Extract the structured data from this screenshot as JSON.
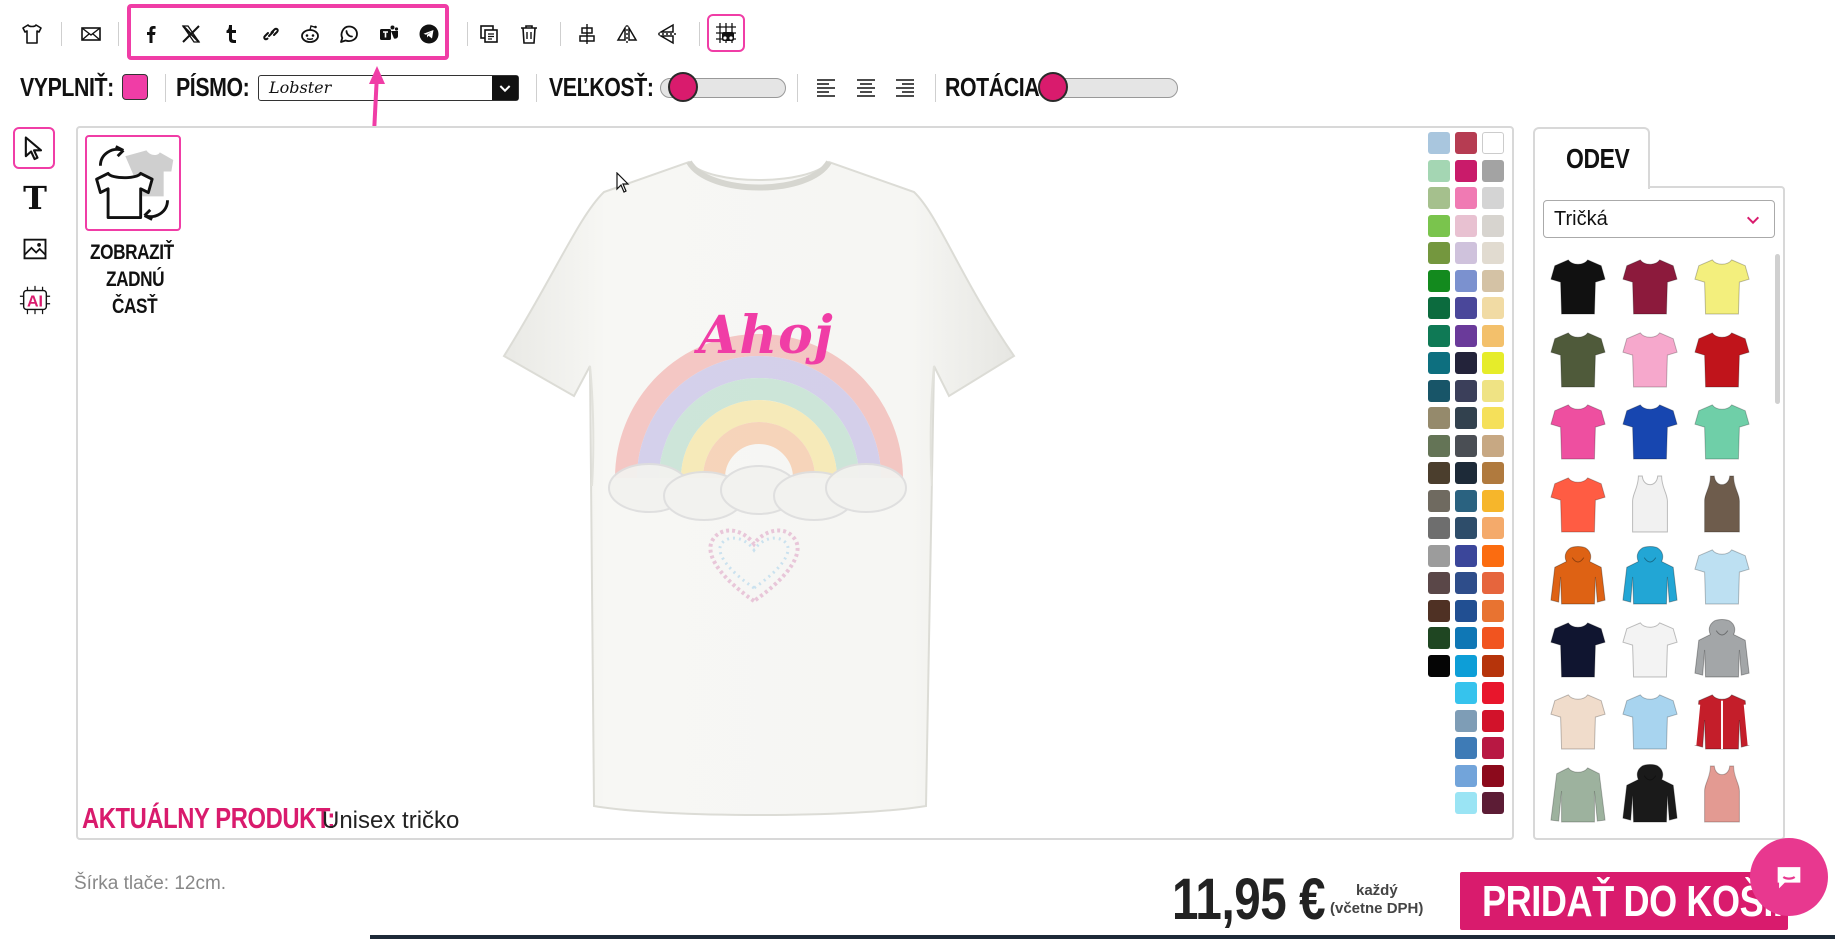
{
  "toolbar": {
    "share_icons": [
      "facebook-icon",
      "x-icon",
      "tumblr-icon",
      "link-icon",
      "reddit-icon",
      "whatsapp-icon",
      "teams-icon",
      "telegram-icon"
    ],
    "fill_label": "VYPLNIŤ:",
    "fill_color": "#f03da6",
    "font_label": "PÍSMO:",
    "font_value": "Lobster",
    "size_label": "VEĽKOSŤ:",
    "size_value": 0.05,
    "rotation_label": "ROTÁCIA:",
    "rotation_value": 0.0
  },
  "back_view": {
    "label_line1": "ZOBRAZIŤ",
    "label_line2": "ZADNÚ",
    "label_line3": "ČASŤ"
  },
  "canvas": {
    "design_text": "Ahoj",
    "current_product_label": "AKTUÁLNY PRODUKT:",
    "current_product_value": "Unisex tričko"
  },
  "palette": {
    "col1": [
      "#a9c6de",
      "#a4d6b3",
      "#a5c08d",
      "#7ac44d",
      "#74973e",
      "#138a1e",
      "#0c6b3e",
      "#0f7955",
      "#0d6f7f",
      "#185568",
      "#958a6c",
      "#647456",
      "#4b3e2d",
      "#6f6a60",
      "#6e6e6e",
      "#9c9c9c",
      "#5a4748",
      "#4f3124",
      "#1f4622",
      "#050505"
    ],
    "col2": [
      "#b63c52",
      "#c91b6a",
      "#f07ab3",
      "#e8c1d1",
      "#cfc2dc",
      "#7b91cf",
      "#4a479a",
      "#6a3a9a",
      "#23233a",
      "#3b3f5a",
      "#32414e",
      "#4a4e54",
      "#1d2a38",
      "#2a6280",
      "#2e4d6a",
      "#3b469a",
      "#2e4d8a",
      "#214f92",
      "#0f77b5",
      "#0d9ed7",
      "#36c3ed",
      "#7e9db6",
      "#3e7bb6",
      "#72a4da",
      "#9ae4f4"
    ],
    "col3": [
      "#ffffff",
      "#a3a3a3",
      "#d4d4d4",
      "#d7d4cf",
      "#e1dbd0",
      "#d4c2a5",
      "#f1dba4",
      "#f3c06b",
      "#e6ec2a",
      "#efe384",
      "#f5e05a",
      "#c7a883",
      "#b07a3e",
      "#f6b62b",
      "#f4aa6b",
      "#fb6c10",
      "#e6653d",
      "#e87331",
      "#f1541f",
      "#b6340b",
      "#e8162c",
      "#d2122a",
      "#b81843",
      "#8c0a1c",
      "#5c1c35"
    ]
  },
  "panel": {
    "tab_label": "ODEV",
    "category_value": "Tričká",
    "garments": [
      {
        "name": "black-tshirt",
        "color": "#111111",
        "type": "tee"
      },
      {
        "name": "maroon-tshirt",
        "color": "#8c1a3c",
        "type": "tee"
      },
      {
        "name": "yellow-tshirt",
        "color": "#f3ef7d",
        "type": "tee"
      },
      {
        "name": "olive-tshirt",
        "color": "#4f5a3a",
        "type": "tee"
      },
      {
        "name": "pink-tshirt",
        "color": "#f6a8cc",
        "type": "tee"
      },
      {
        "name": "red-tshirt",
        "color": "#c0141b",
        "type": "tee"
      },
      {
        "name": "hotpink-tshirt",
        "color": "#ee4fa0",
        "type": "tee"
      },
      {
        "name": "royal-tshirt",
        "color": "#1746b0",
        "type": "tee"
      },
      {
        "name": "mint-tshirt",
        "color": "#6fcfa8",
        "type": "tee"
      },
      {
        "name": "coral-tshirt",
        "color": "#ff5c43",
        "type": "tee"
      },
      {
        "name": "white-tank",
        "color": "#f1f1f1",
        "type": "tank"
      },
      {
        "name": "brown-tank",
        "color": "#6e5c4c",
        "type": "tank"
      },
      {
        "name": "orange-hoodie",
        "color": "#de6214",
        "type": "hoodie"
      },
      {
        "name": "cyan-hoodie",
        "color": "#22a6d5",
        "type": "hoodie"
      },
      {
        "name": "tiedye-tshirt",
        "color": "#bde0f2",
        "type": "tee"
      },
      {
        "name": "navy-tshirt",
        "color": "#101530",
        "type": "tee"
      },
      {
        "name": "raglan-tshirt",
        "color": "#f3f3f3",
        "type": "tee"
      },
      {
        "name": "grey-hoodie",
        "color": "#a3a6a8",
        "type": "hoodie"
      },
      {
        "name": "cream-tshirt",
        "color": "#f0dccb",
        "type": "tee"
      },
      {
        "name": "dipdye-tshirt",
        "color": "#a8d4ef",
        "type": "tee"
      },
      {
        "name": "red-jacket",
        "color": "#c41e2a",
        "type": "jacket"
      },
      {
        "name": "sage-longsleeve",
        "color": "#9db29e",
        "type": "long"
      },
      {
        "name": "black-orange-hoodie",
        "color": "#1a1a1a",
        "type": "hoodie"
      },
      {
        "name": "rose-tank",
        "color": "#e39a92",
        "type": "tank"
      }
    ]
  },
  "footer": {
    "print_width": "Šírka tlače: 12cm.",
    "price": "11,95 €",
    "price_note_1": "každý",
    "price_note_2": "(včetne DPH)",
    "add_to_cart": "PRIDAŤ DO KOŠÍKA"
  },
  "colors": {
    "accent": "#f03da6",
    "cart": "#d91b6d"
  }
}
